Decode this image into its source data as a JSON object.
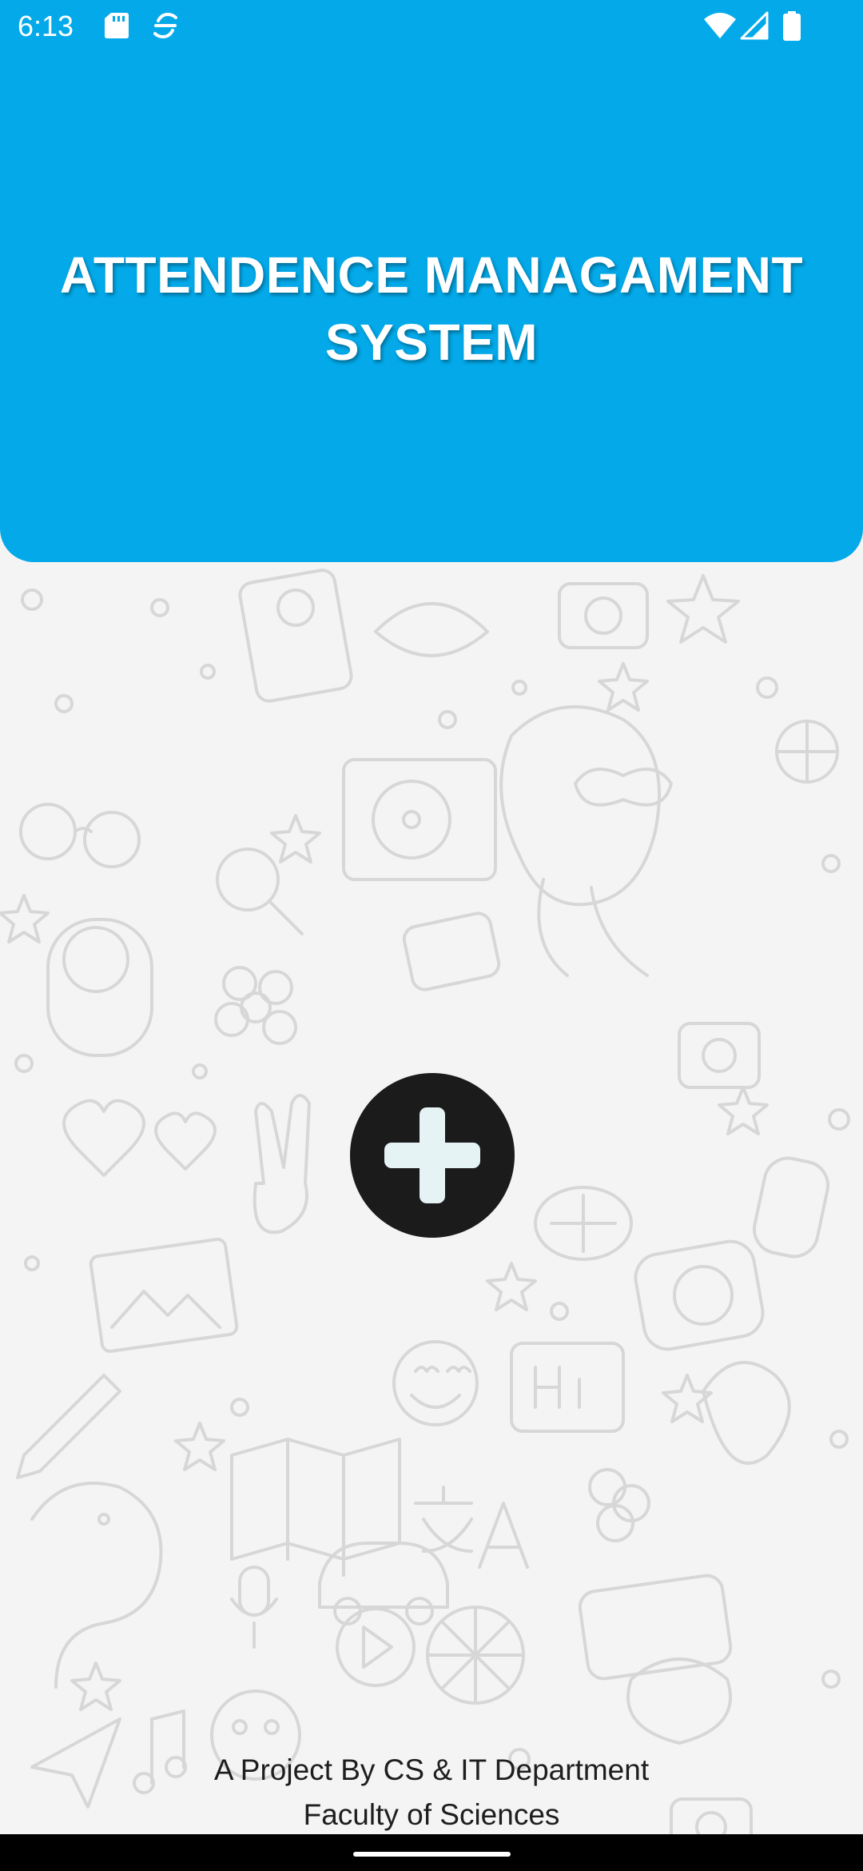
{
  "status_bar": {
    "time": "6:13",
    "icons": [
      "sd-card-icon",
      "sync-icon",
      "wifi-icon",
      "cell-signal-icon",
      "battery-icon"
    ]
  },
  "header": {
    "title_line1": "ATTENDENCE MANAGAMENT",
    "title_line2": "SYSTEM",
    "background_color": "#03A9E9"
  },
  "fab": {
    "icon": "plus-icon",
    "background_color": "#1B1B1B",
    "icon_color": "#E6F3F5"
  },
  "footer": {
    "line1": "A Project By CS & IT Department",
    "line2": "Faculty of Sciences"
  }
}
